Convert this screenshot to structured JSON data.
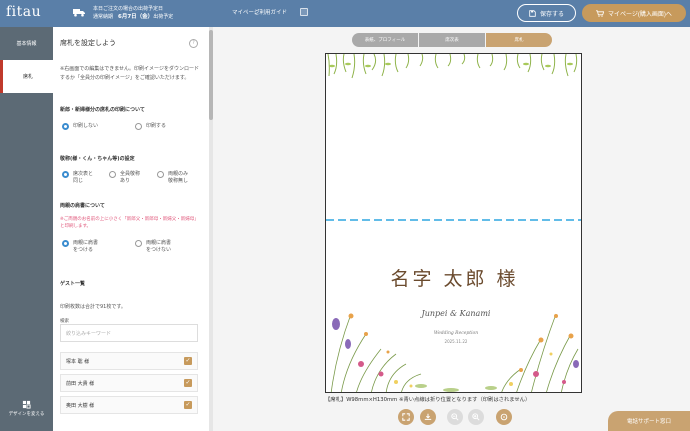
{
  "header": {
    "logo": "fitau",
    "notice_line1": "本日ご注文の場合の出荷予定日",
    "notice_line2_prefix": "通常納期",
    "notice_line2_date": "6月7日（金）",
    "notice_line2_suffix": "出荷予定",
    "mypage_link": "マイページ",
    "guide_link": "ご利用ガイド",
    "save_label": "保存する",
    "mypage_button_label": "マイページ(購入画面)へ"
  },
  "nav": {
    "basic_info": "基本情報",
    "seat_card": "席札",
    "design_change": "デザインを変える"
  },
  "panel": {
    "title": "席札を設定しよう",
    "note": "※右画面での編集はできません。印刷イメージをダウンロードするか「全員分の印刷イメージ」をご確認いただけます。",
    "couple_print_label": "新郎・新婦様分の席札の印刷について",
    "no_print": "印刷しない",
    "print": "印刷する",
    "honorific_label": "敬称(様・くん・ちゃん等)の設定",
    "same_as_seating_line1": "席次表と",
    "same_as_seating_line2": "同じ",
    "all_honorific_line1": "全員敬称",
    "all_honorific_line2": "あり",
    "parents_none_line1": "両親のみ",
    "parents_none_line2": "敬称無し",
    "parents_title_label": "両親の肩書について",
    "warning": "※ご両親のお名前の上に小さく「新郎父・新郎母・新婦父・新婦母」と印刷します。",
    "parents_with_line1": "両親に肩書",
    "parents_with_line2": "をつける",
    "parents_without_line1": "両親に肩書",
    "parents_without_line2": "をつけない",
    "guest_list_label": "ゲスト一覧",
    "print_count": "印刷枚数は合計で91枚です。",
    "search_label": "検索",
    "search_placeholder": "絞り込みキーワード",
    "guests": [
      {
        "name": "塚本 聡 様",
        "checked": true
      },
      {
        "name": "前田 大貴 様",
        "checked": true
      },
      {
        "name": "奥田 大樹 様",
        "checked": true
      }
    ]
  },
  "preview": {
    "tabs": [
      "表紙、プロフィール",
      "席次表",
      "席札"
    ],
    "active_tab": "席札",
    "guest_name": "名字 太郎 様",
    "couple": "Junpei & Kanami",
    "wedding_text": "Wedding Reception",
    "wedding_date": "2025.11.22",
    "caption": "【席札】W98mm×H130mm ※青い点線は折り位置となります（印刷はされません）",
    "fold_line_color": "#2fa6e0"
  },
  "support_button": "電話サポート窓口",
  "colors": {
    "header": "#5a7fa8",
    "accent_gold": "#c9a371",
    "radio_blue": "#3a8ccf",
    "warning_pink": "#e0567a"
  }
}
